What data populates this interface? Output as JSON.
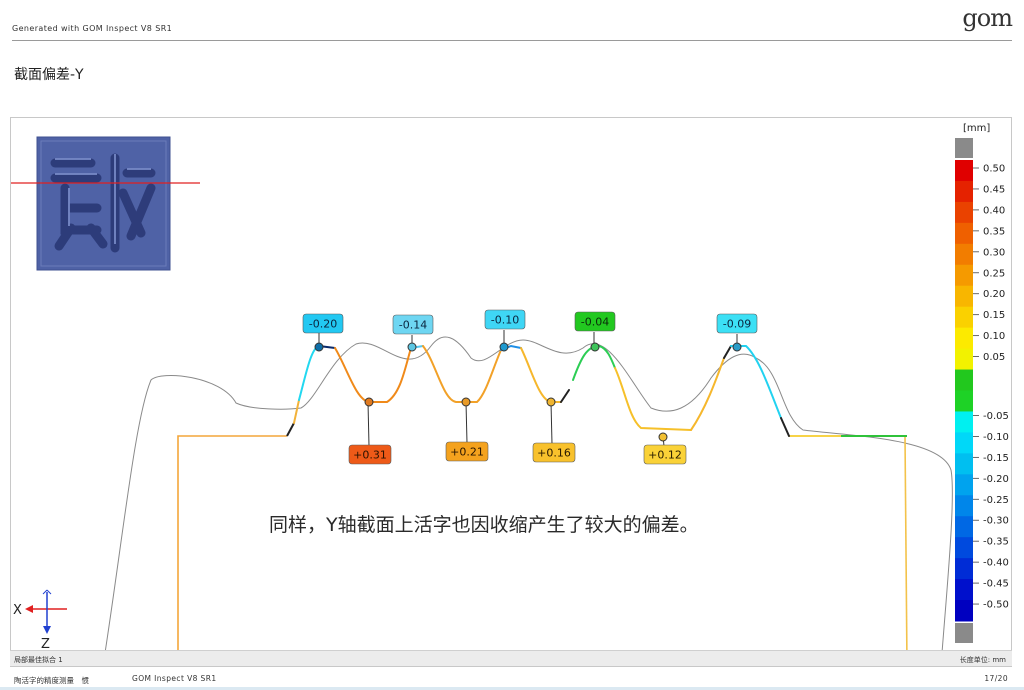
{
  "header": {
    "generated_text": "Generated with GOM Inspect V8 SR1",
    "logo_text": "gom"
  },
  "page_title": "截面偏差-Y",
  "annotation_text": "同样，Y轴截面上活字也因收缩产生了较大的偏差。",
  "labels": {
    "top": [
      "-0.20",
      "-0.14",
      "-0.10",
      "-0.04",
      "-0.09"
    ],
    "bottom": [
      "+0.31",
      "+0.21",
      "+0.16",
      "+0.12"
    ]
  },
  "legend": {
    "unit": "[mm]",
    "positive": [
      "0.50",
      "0.45",
      "0.40",
      "0.35",
      "0.30",
      "0.25",
      "0.20",
      "0.15",
      "0.10",
      "0.05"
    ],
    "negative": [
      "-0.05",
      "-0.10",
      "-0.15",
      "-0.20",
      "-0.25",
      "-0.30",
      "-0.35",
      "-0.40",
      "-0.45",
      "-0.50"
    ],
    "colors": [
      "#e00000",
      "#e52200",
      "#ea4200",
      "#ef6000",
      "#f27d00",
      "#f59a00",
      "#f8b600",
      "#fad100",
      "#fcea00",
      "#f2f200",
      "#22c81e",
      "#1ed226",
      "#00f0f0",
      "#00d8f8",
      "#00bff0",
      "#00a3ee",
      "#0086ea",
      "#0068e4",
      "#004ade",
      "#002cd6",
      "#0010cc",
      "#0000c0"
    ]
  },
  "axes": {
    "x": "X",
    "z": "Z"
  },
  "status": {
    "left": "局部最佳拟合 1",
    "right": "长度单位: mm"
  },
  "footer": {
    "left_text": "陶活字的精度测量　惯",
    "product": "GOM Inspect V8 SR1",
    "page": "17/20"
  }
}
